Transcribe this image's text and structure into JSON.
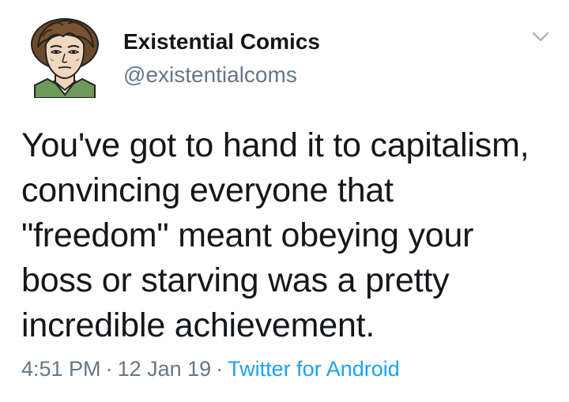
{
  "user": {
    "display_name": "Existential Comics",
    "handle": "@existentialcoms",
    "avatar_icon": "cartoon-portrait-avatar"
  },
  "tweet": {
    "text": "You've got to hand it to capitalism,\nconvincing everyone that\n\"freedom\" meant obeying your\nboss or starving was a pretty\nincredible achievement.",
    "time": "4:51 PM",
    "date": "12 Jan 19",
    "separator": "·",
    "source": "Twitter for Android"
  },
  "icons": {
    "menu": "chevron-down-icon"
  },
  "colors": {
    "text": "#14171a",
    "secondary": "#657786",
    "link": "#1da1f2"
  }
}
